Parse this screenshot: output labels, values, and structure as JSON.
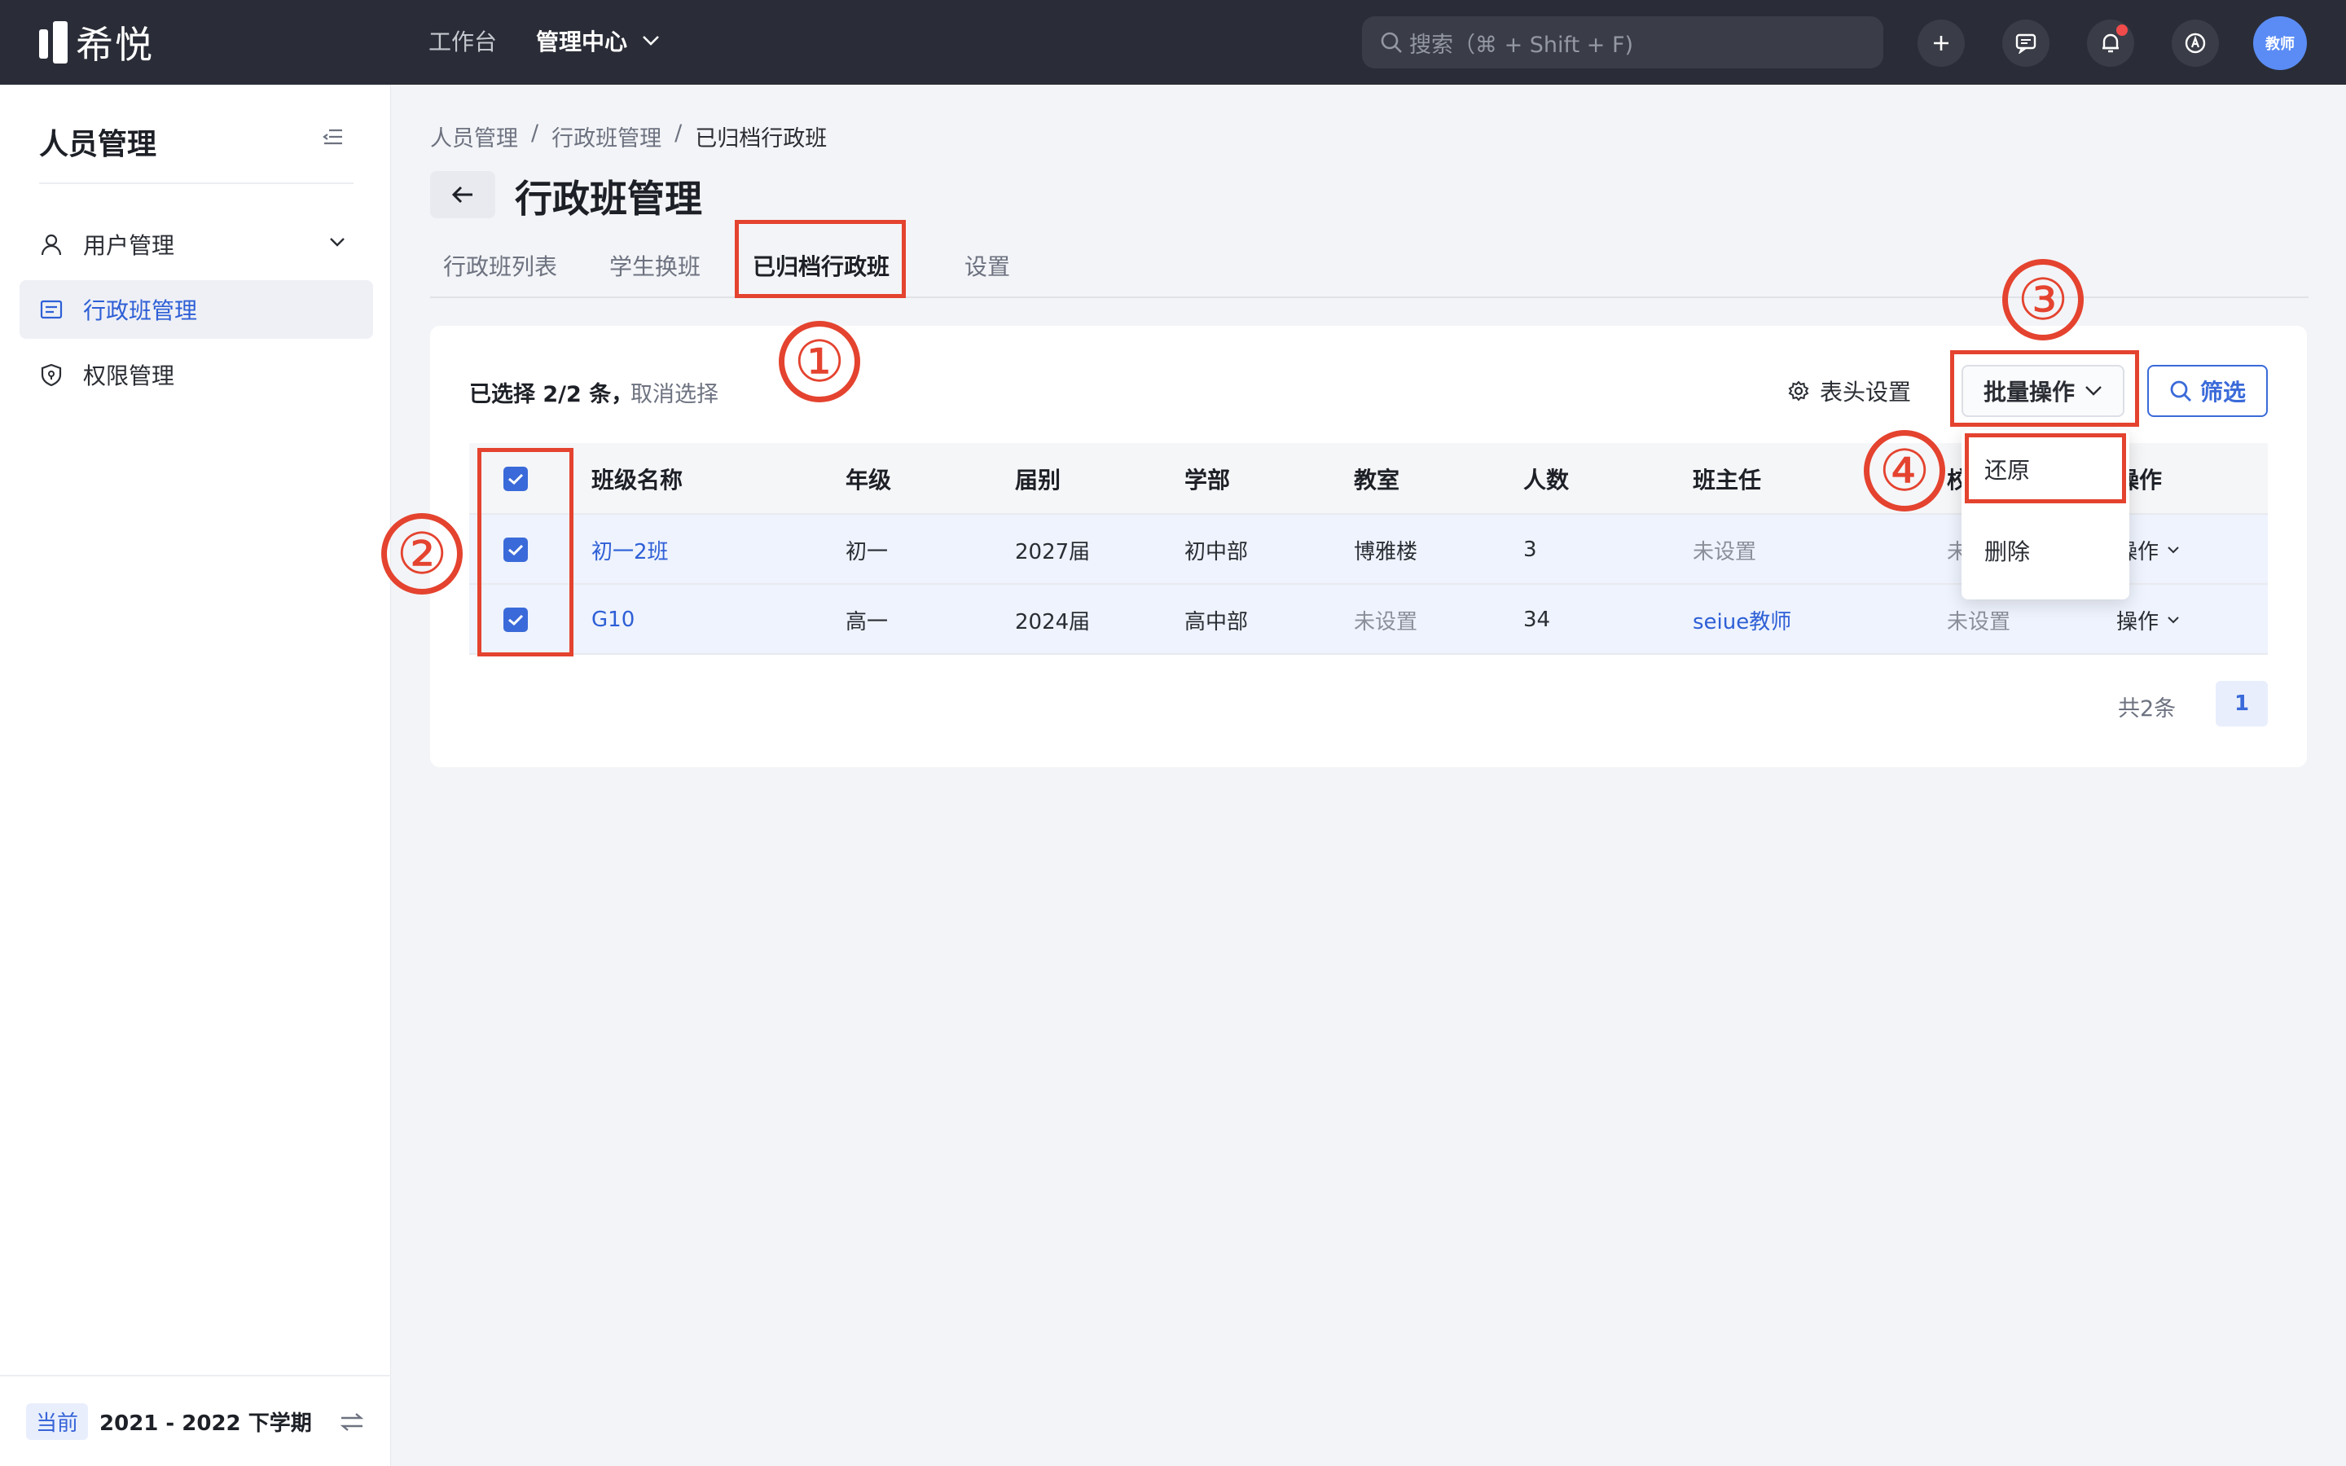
{
  "topbar": {
    "logo_text": "希悦",
    "nav": [
      "工作台",
      "管理中心"
    ],
    "search_placeholder": "搜索（⌘ + Shift + F)",
    "avatar_text": "教师",
    "notification_dot_color": "#f04b4b"
  },
  "sidebar": {
    "title": "人员管理",
    "items": [
      {
        "label": "用户管理",
        "icon": "user-icon"
      },
      {
        "label": "行政班管理",
        "icon": "class-list-icon",
        "active": true
      },
      {
        "label": "权限管理",
        "icon": "shield-icon"
      }
    ],
    "term_badge": "当前",
    "term_text": "2021 - 2022 下学期"
  },
  "breadcrumb": [
    "人员管理",
    "/",
    "行政班管理",
    "/",
    "已归档行政班"
  ],
  "page_title": "行政班管理",
  "tabs": [
    "行政班列表",
    "学生换班",
    "已归档行政班",
    "设置"
  ],
  "active_tab": "已归档行政班",
  "toolbar": {
    "selected_text": "已选择 2/2 条，",
    "cancel_select": "取消选择",
    "column_settings": "表头设置",
    "batch_ops": "批量操作",
    "filter": "筛选"
  },
  "table": {
    "columns": [
      "班级名称",
      "年级",
      "届别",
      "学部",
      "教室",
      "人数",
      "班主任",
      "校",
      "操作"
    ],
    "rows": [
      {
        "name": "初一2班",
        "grade": "初一",
        "cohort": "2027届",
        "division": "初中部",
        "room": "博雅楼",
        "count": "3",
        "head_teacher": "未设置",
        "campus": "未",
        "ops": "操作",
        "checked": true
      },
      {
        "name": "G10",
        "grade": "高一",
        "cohort": "2024届",
        "division": "高中部",
        "room": "未设置",
        "count": "34",
        "head_teacher": "seiue教师",
        "campus": "未设置",
        "ops": "操作",
        "checked": true
      }
    ]
  },
  "pagination": {
    "total": "共2条",
    "current_page": "1"
  },
  "batch_menu": [
    "还原",
    "删除"
  ],
  "annotations": [
    "①",
    "②",
    "③",
    "④"
  ],
  "colors": {
    "accent": "#3a6ad9",
    "annotation_red": "#e4432f",
    "topbar_bg": "#2a2d37"
  }
}
